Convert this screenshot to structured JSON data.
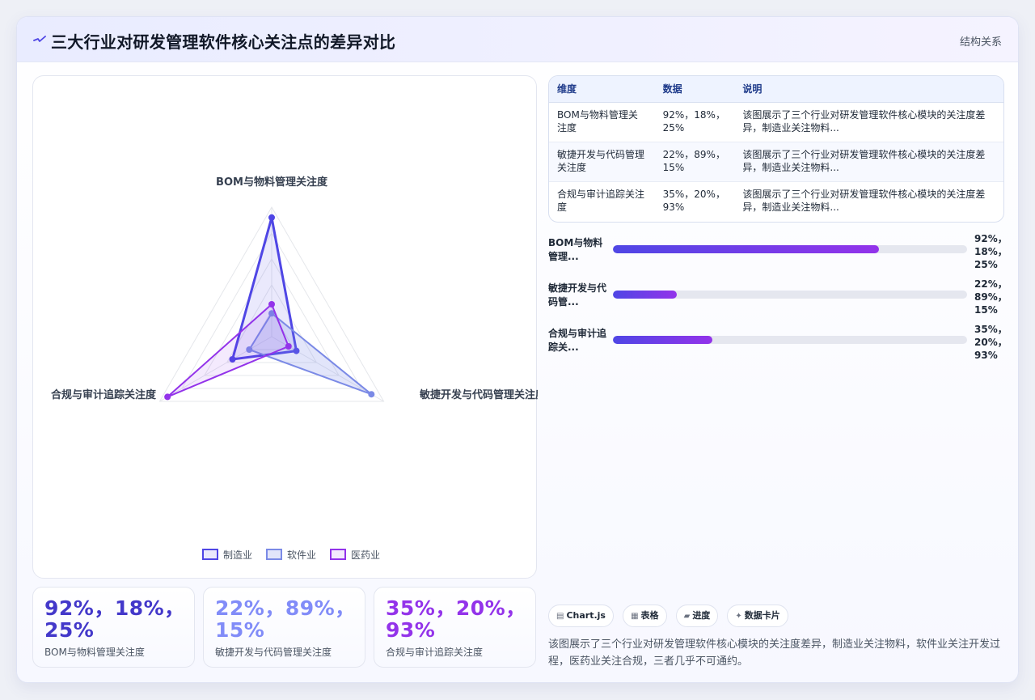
{
  "header": {
    "title": "三大行业对研发管理软件核心关注点的差异对比",
    "badge": "结构关系",
    "accent": "#4f46e5"
  },
  "chart_data": {
    "type": "radar",
    "axes": [
      "BOM与物料管理关注度",
      "敏捷开发与代码管理关注度",
      "合规与审计追踪关注度"
    ],
    "range": [
      0,
      100
    ],
    "grid": true,
    "legend_position": "bottom",
    "series": [
      {
        "name": "制造业",
        "values": [
          92,
          22,
          35
        ],
        "color": "#4f46e5"
      },
      {
        "name": "软件业",
        "values": [
          18,
          89,
          20
        ],
        "color": "#7b8ae6"
      },
      {
        "name": "医药业",
        "values": [
          25,
          15,
          93
        ],
        "color": "#9333ea"
      }
    ]
  },
  "stats": [
    {
      "value": "92%，18%，25%",
      "label": "BOM与物料管理关注度",
      "color": "#4338ca"
    },
    {
      "value": "22%，89%，15%",
      "label": "敏捷开发与代码管理关注度",
      "color": "#818cf8"
    },
    {
      "value": "35%，20%，93%",
      "label": "合规与审计追踪关注度",
      "color": "#9333ea"
    }
  ],
  "table": {
    "headers": [
      "维度",
      "数据",
      "说明"
    ],
    "rows": [
      {
        "dimension": "BOM与物料管理关注度",
        "data": "92%，18%，25%",
        "note": "该图展示了三个行业对研发管理软件核心模块的关注度差异，制造业关注物料..."
      },
      {
        "dimension": "敏捷开发与代码管理关注度",
        "data": "22%，89%，15%",
        "note": "该图展示了三个行业对研发管理软件核心模块的关注度差异，制造业关注物料..."
      },
      {
        "dimension": "合规与审计追踪关注度",
        "data": "35%，20%，93%",
        "note": "该图展示了三个行业对研发管理软件核心模块的关注度差异，制造业关注物料..."
      }
    ]
  },
  "progress": [
    {
      "label": "BOM与物料管理...",
      "value_text": "92%，18%，25%",
      "fill": 0.75
    },
    {
      "label": "敏捷开发与代码管...",
      "value_text": "22%，89%，15%",
      "fill": 0.18
    },
    {
      "label": "合规与审计追踪关...",
      "value_text": "35%，20%，93%",
      "fill": 0.28
    }
  ],
  "tags": [
    {
      "icon": "▤",
      "label": "Chart.js"
    },
    {
      "icon": "▦",
      "label": "表格"
    },
    {
      "icon": "▰",
      "label": "进度"
    },
    {
      "icon": "✦",
      "label": "数据卡片"
    }
  ],
  "summary": "该图展示了三个行业对研发管理软件核心模块的关注度差异，制造业关注物料，软件业关注开发过程，医药业关注合规，三者几乎不可通约。"
}
